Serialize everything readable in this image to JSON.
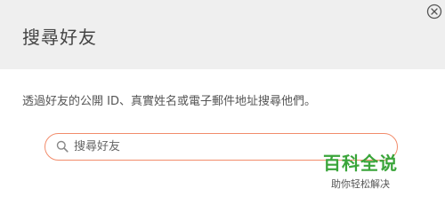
{
  "dialog": {
    "title": "搜尋好友",
    "close_icon": "close-circle-icon",
    "description": "透過好友的公開 ID、真實姓名或電子郵件地址搜尋他們。",
    "search": {
      "placeholder": "搜尋好友",
      "value": "",
      "icon": "search-icon"
    }
  },
  "watermark": {
    "title": "百科全说",
    "subtitle": "助你轻松解决"
  },
  "colors": {
    "header_bg": "#efefef",
    "search_border": "#f28c6b",
    "watermark_green": "#3aa53a"
  }
}
